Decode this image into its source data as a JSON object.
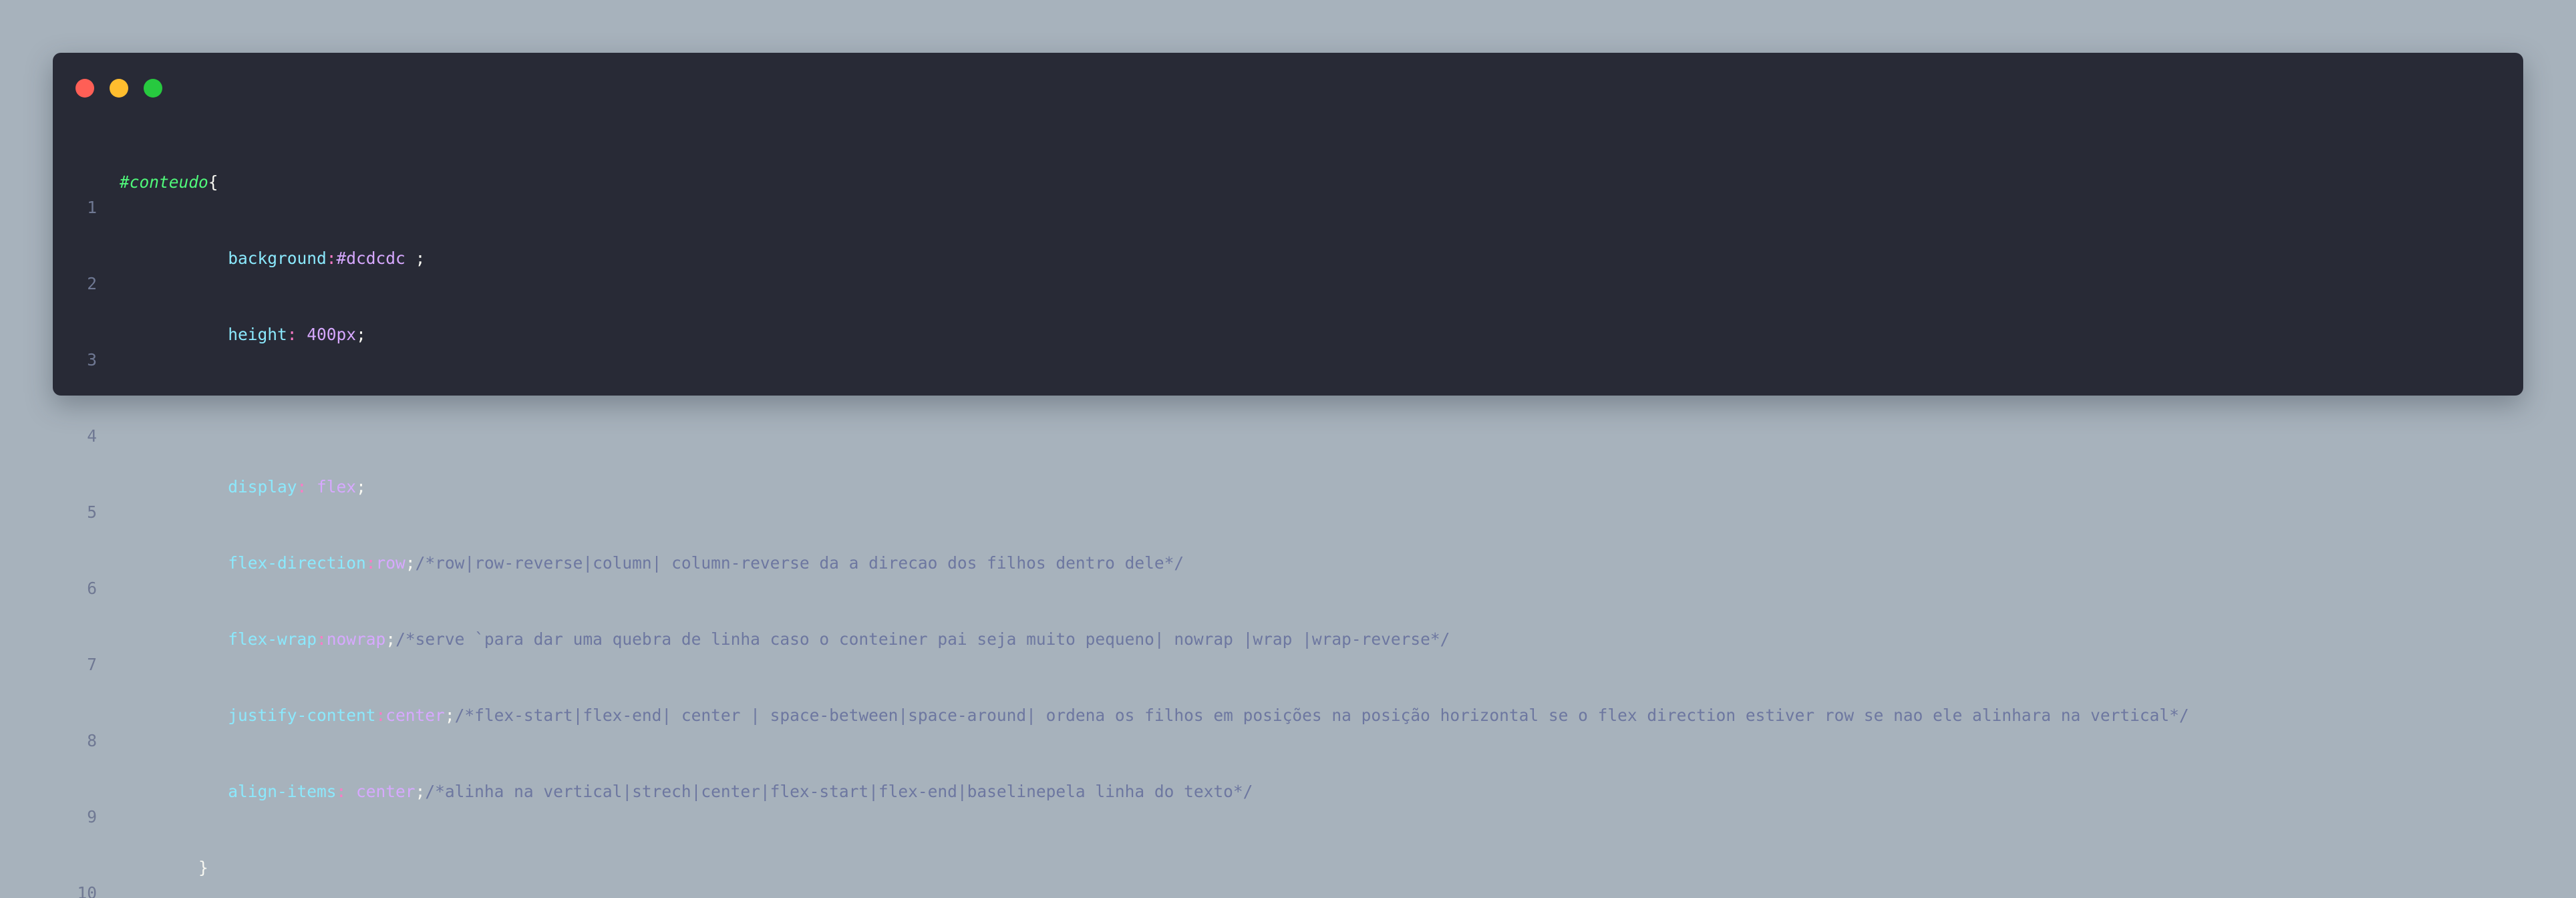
{
  "window_controls": {
    "close_color": "#ff5f56",
    "minimize_color": "#ffbd2e",
    "maximize_color": "#27c93f"
  },
  "code": {
    "line_numbers": [
      "1",
      "2",
      "3",
      "4",
      "5",
      "6",
      "7",
      "8",
      "9",
      "10"
    ],
    "line1": {
      "selector": "#conteudo",
      "brace": "{"
    },
    "line2": {
      "indent": "           ",
      "prop": "background",
      "colon": ":",
      "value": "#dcdcdc",
      "end": " ;"
    },
    "line3": {
      "indent": "           ",
      "prop": "height",
      "colon": ":",
      "value": " 400px",
      "end": ";"
    },
    "line5": {
      "indent": "           ",
      "prop": "display",
      "colon": ":",
      "value": " flex",
      "end": ";"
    },
    "line6": {
      "indent": "           ",
      "prop": "flex-direction",
      "colon": ":",
      "value": "row",
      "end": ";",
      "comment": "/*row|row-reverse|column| column-reverse da a direcao dos filhos dentro dele*/"
    },
    "line7": {
      "indent": "           ",
      "prop": "flex-wrap",
      "colon": ":",
      "value": "nowrap",
      "end": ";",
      "comment": "/*serve `para dar uma quebra de linha caso o conteiner pai seja muito pequeno| nowrap |wrap |wrap-reverse*/"
    },
    "line8": {
      "indent": "           ",
      "prop": "justify-content",
      "colon": ":",
      "value": "center",
      "end": ";",
      "comment": "/*flex-start|flex-end| center | space-between|space-around| ordena os filhos em posições na posição horizontal se o flex direction estiver row se nao ele alinhara na vertical*/"
    },
    "line9": {
      "indent": "           ",
      "prop": "align-items",
      "colon": ":",
      "value": " center",
      "end": ";",
      "comment": "/*alinha na vertical|strech|center|flex-start|flex-end|baselinepela linha do texto*/"
    },
    "line10": {
      "indent": "        ",
      "brace": "}"
    }
  }
}
